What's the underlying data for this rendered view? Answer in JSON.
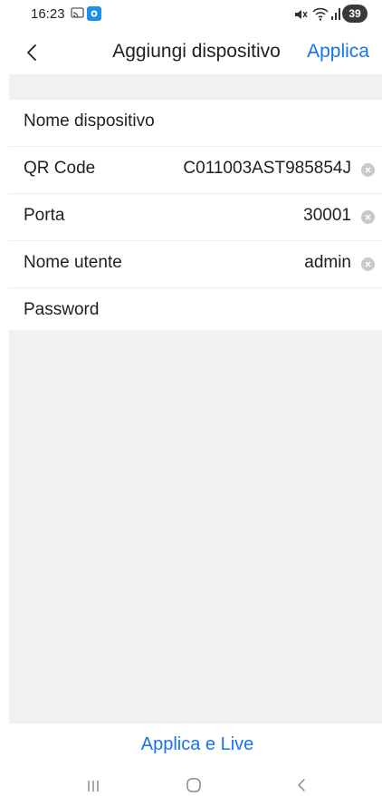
{
  "status_bar": {
    "time": "16:23",
    "battery": "39",
    "icons": [
      "cast-icon",
      "app-notification-icon",
      "mute-icon",
      "wifi-icon",
      "signal-icon",
      "battery-icon"
    ]
  },
  "header": {
    "back_icon": "chevron-left-icon",
    "title": "Aggiungi dispositivo",
    "apply_label": "Applica"
  },
  "form": {
    "rows": [
      {
        "label": "Nome dispositivo",
        "value": ""
      },
      {
        "label": "QR Code",
        "value": "C011003AST985854J"
      },
      {
        "label": "Porta",
        "value": "30001"
      },
      {
        "label": "Nome utente",
        "value": "admin"
      },
      {
        "label": "Password",
        "value": ""
      }
    ]
  },
  "footer": {
    "apply_live_label": "Applica e Live"
  },
  "nav_bar": {
    "icons": [
      "recents-icon",
      "home-icon",
      "back-icon"
    ]
  },
  "colors": {
    "accent": "#1a73e8",
    "background_gray": "#f1f1f3",
    "divider": "#ececec",
    "clear_icon": "#c8c8cc"
  }
}
